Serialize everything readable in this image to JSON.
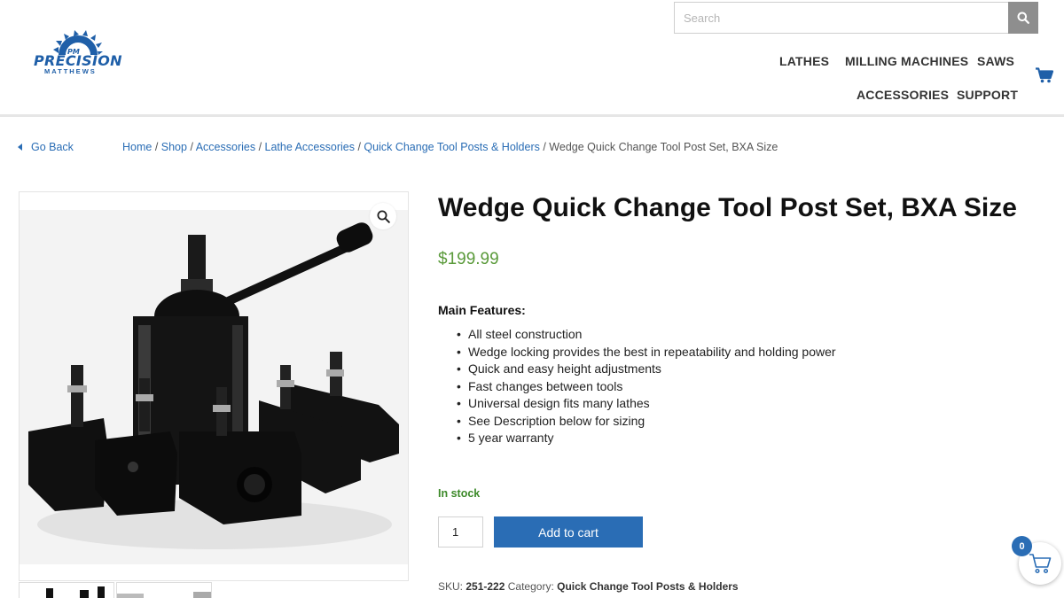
{
  "brand": {
    "name": "PRECISION",
    "sub": "MATTHEWS",
    "badge": "PM",
    "color": "#1f5fa8"
  },
  "search": {
    "placeholder": "Search",
    "icon": "search-icon"
  },
  "nav": {
    "items": [
      {
        "label": "LATHES"
      },
      {
        "label": "MILLING MACHINES"
      },
      {
        "label": "SAWS"
      },
      {
        "label": "ACCESSORIES"
      },
      {
        "label": "SUPPORT"
      }
    ],
    "cart_icon": "cart-icon"
  },
  "breadcrumb": {
    "back_label": "Go Back",
    "links": [
      "Home",
      "Shop",
      "Accessories",
      "Lathe Accessories",
      "Quick Change Tool Posts & Holders"
    ],
    "current": "Wedge Quick Change Tool Post Set, BXA Size"
  },
  "product": {
    "title": "Wedge Quick Change Tool Post Set, BXA Size",
    "price": "$199.99",
    "features_title": "Main Features:",
    "features": [
      "All steel construction",
      "Wedge locking provides the best in repeatability and holding power",
      "Quick and easy height adjustments",
      "Fast changes between tools",
      "Universal design fits many lathes",
      "See Description below for sizing",
      "5 year warranty"
    ],
    "stock": "In stock",
    "quantity": "1",
    "add_to_cart": "Add to cart",
    "sku_label": "SKU:",
    "sku": "251-222",
    "category_label": "Category:",
    "category": "Quick Change Tool Posts & Holders"
  },
  "floating_cart": {
    "count": "0"
  },
  "colors": {
    "accent": "#2a6db5",
    "price": "#5a9a3a",
    "stock": "#3d8a2a"
  }
}
